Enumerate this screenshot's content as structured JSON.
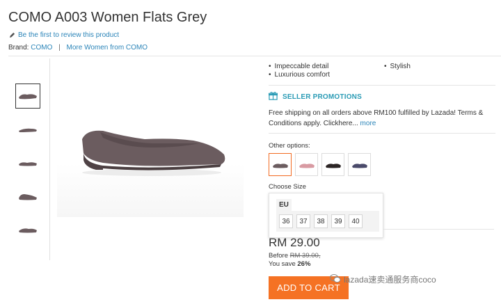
{
  "product": {
    "title": "COMO A003 Women Flats Grey",
    "review_link": "Be the first to review this product",
    "brand_label": "Brand:",
    "brand_name": "COMO",
    "brand_separator": "|",
    "more_from_brand": "More Women from COMO"
  },
  "highlights": [
    "Impeccable detail",
    "Luxurious comfort",
    "Stylish"
  ],
  "promotions": {
    "heading": "SELLER PROMOTIONS",
    "text": "Free shipping on all orders above RM100 fulfilled by Lazada! Terms & Conditions apply. Clickhere...",
    "more_link": "more"
  },
  "options": {
    "other_label": "Other options:",
    "swatch_colors": [
      "#6b5c5f",
      "#d89aa2",
      "#2b2424",
      "#4a4a6a"
    ],
    "selected_index": 0
  },
  "size": {
    "label": "Choose Size",
    "system_tab": "EU",
    "sizes": [
      "36",
      "37",
      "38",
      "39",
      "40"
    ]
  },
  "pricing": {
    "price": "RM 29.00",
    "before_label": "Before",
    "before_price": "RM 39.00,",
    "save_label": "You save",
    "save_percent": "26%"
  },
  "actions": {
    "add_to_cart": "ADD TO CART"
  },
  "watermark": {
    "text": "lazada速卖通服务商coco"
  },
  "colors": {
    "accent": "#f57224",
    "link": "#2a84b8",
    "promo": "#2a9bb5",
    "product": "#6b5c5f"
  }
}
